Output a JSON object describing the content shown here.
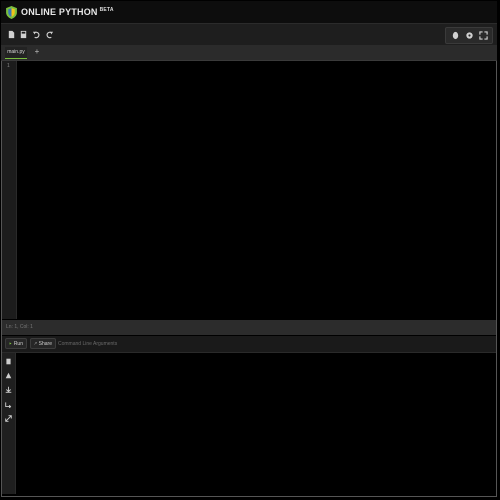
{
  "app": {
    "title": "ONLINE PYTHON",
    "badge": "BETA"
  },
  "toolbar": {
    "left_icons": [
      "new-file-icon",
      "save-icon",
      "undo-icon",
      "redo-icon"
    ],
    "right_icons": [
      "upload-icon",
      "settings-icon",
      "fullscreen-icon"
    ]
  },
  "tabs": [
    {
      "label": "main.py"
    }
  ],
  "tab_add_label": "+",
  "editor": {
    "line_numbers": [
      "1"
    ]
  },
  "status": {
    "cursor": "Ln: 1, Col: 1"
  },
  "actions": {
    "run_label": "Run",
    "share_label": "Share",
    "args_placeholder": "Command Line Arguments"
  },
  "output_icons": [
    "copy-icon",
    "clear-icon",
    "download-icon",
    "wrap-icon",
    "expand-icon"
  ],
  "colors": {
    "accent": "#7abf3f",
    "background": "#000000",
    "panel": "#1e1e1e"
  }
}
